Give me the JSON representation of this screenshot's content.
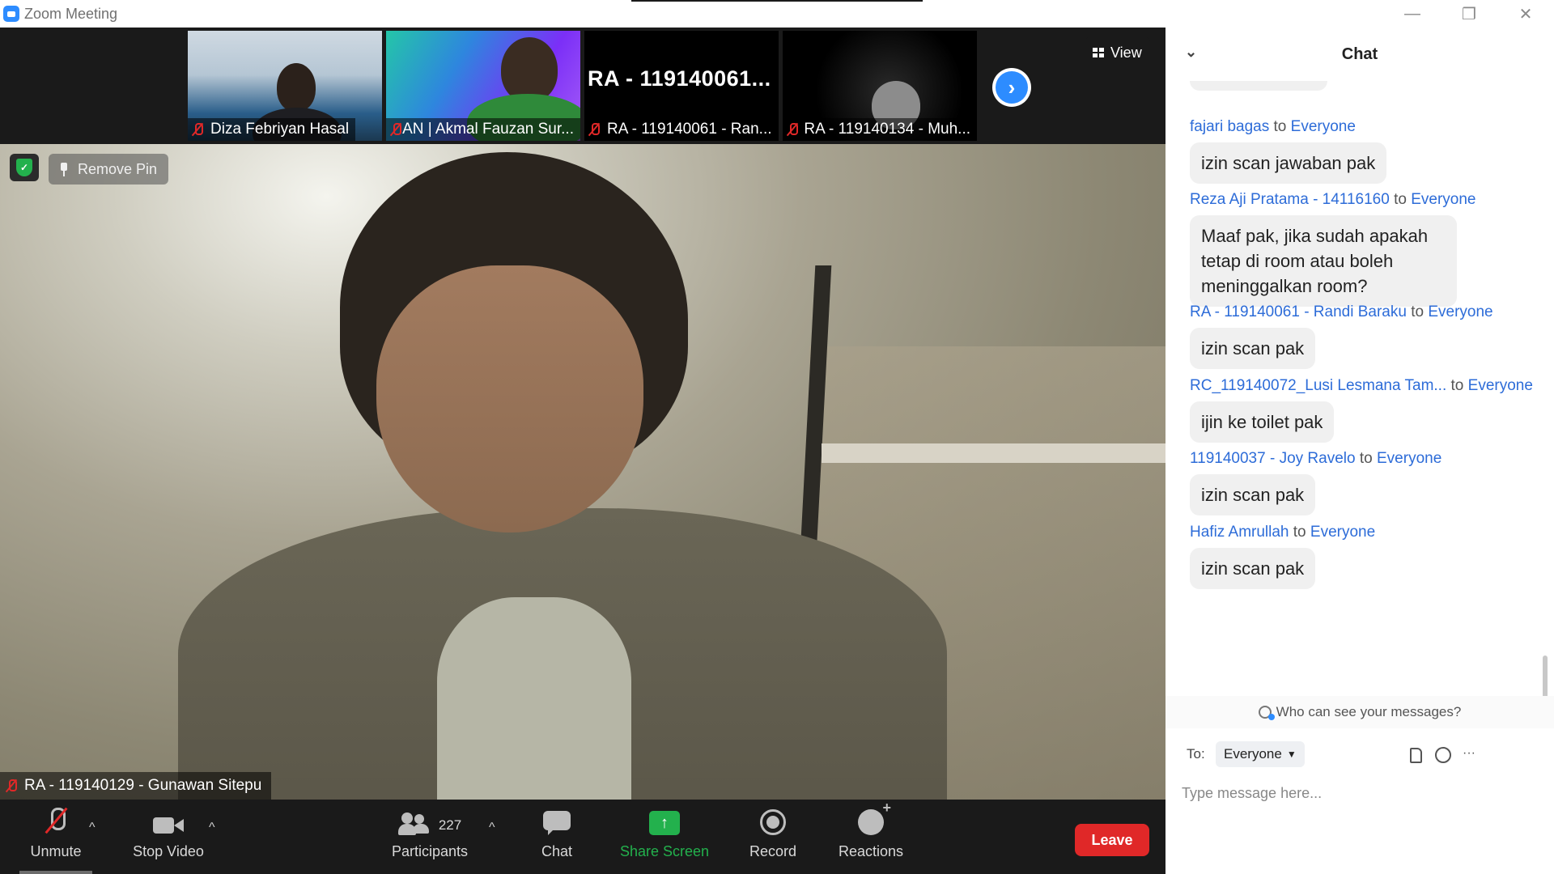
{
  "window": {
    "title": "Zoom Meeting",
    "minimize": "—",
    "restore": "❐",
    "close": "✕"
  },
  "thumbnails": [
    {
      "name": "Diza Febriyan Hasal",
      "muted": true
    },
    {
      "name": "AN | Akmal Fauzan Sur...",
      "muted": true
    },
    {
      "name": "RA - 119140061 - Ran...",
      "muted": true,
      "big_label": "RA - 119140061..."
    },
    {
      "name": "RA - 119140134 - Muh...",
      "muted": true
    }
  ],
  "view_button": "View",
  "next_page_icon": "›",
  "remove_pin": "Remove Pin",
  "main_video": {
    "name": "RA - 119140129 - Gunawan Sitepu",
    "muted": true
  },
  "toolbar": {
    "unmute": "Unmute",
    "stop_video": "Stop Video",
    "participants": "Participants",
    "participants_count": "227",
    "chat": "Chat",
    "share_screen": "Share Screen",
    "record": "Record",
    "reactions": "Reactions",
    "leave": "Leave",
    "caret": "^"
  },
  "chat": {
    "title": "Chat",
    "collapse_icon": "⌄",
    "messages": [
      {
        "sender": "fajari bagas",
        "to": "to",
        "recipient": "Everyone",
        "text": "izin scan jawaban pak"
      },
      {
        "sender": "Reza Aji Pratama - 14116160",
        "to": "to",
        "recipient": "Everyone",
        "text": "Maaf pak, jika sudah apakah tetap di room atau boleh meninggalkan room?"
      },
      {
        "sender": "RA - 119140061 - Randi Baraku",
        "to": "to",
        "recipient": "Everyone",
        "text": "izin scan pak"
      },
      {
        "sender": "RC_119140072_Lusi Lesmana Tam...",
        "to": "to",
        "recipient": "Everyone",
        "text": "ijin ke toilet pak"
      },
      {
        "sender": "119140037 - Joy Ravelo",
        "to": "to",
        "recipient": "Everyone",
        "text": "izin scan pak"
      },
      {
        "sender": "Hafiz Amrullah",
        "to": "to",
        "recipient": "Everyone",
        "text": "izin scan pak"
      }
    ],
    "who_can_see": "Who can see your messages?",
    "to_label": "To:",
    "to_value": "Everyone",
    "more_icon": "···",
    "input_placeholder": "Type message here..."
  },
  "colors": {
    "accent": "#2d8cff",
    "leave": "#e02828",
    "share": "#23b14d"
  }
}
